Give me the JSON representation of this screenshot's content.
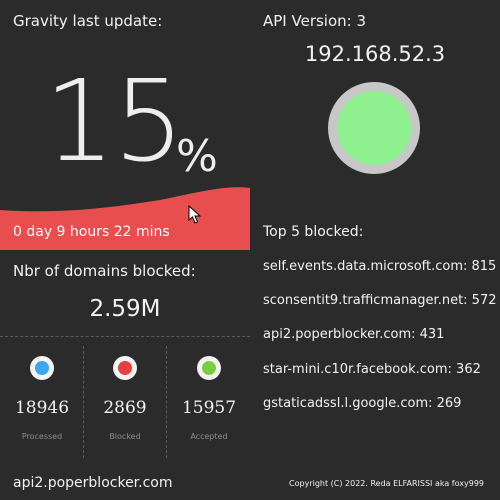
{
  "gravity": {
    "title": "Gravity last update:",
    "percent": "15",
    "percent_sign": "%",
    "duration": "0 day 9 hours 22 mins",
    "accent": "#e84e4e"
  },
  "domains": {
    "title": "Nbr of domains blocked:",
    "count": "2.59M"
  },
  "stats": [
    {
      "value": "18946",
      "label": "Processed",
      "color": "#3aa7f0"
    },
    {
      "value": "2869",
      "label": "Blocked",
      "color": "#e84040"
    },
    {
      "value": "15957",
      "label": "Accepted",
      "color": "#7ccc40"
    }
  ],
  "footer": {
    "domain": "api2.poperblocker.com",
    "copyright": "Copyright (C) 2022.  Reda ELFARISSI aka foxy999"
  },
  "api": {
    "version": "API Version: 3",
    "ip": "192.168.52.3",
    "status_color": "#8ff08f"
  },
  "top5": {
    "title": "Top 5 blocked:",
    "items": [
      "self.events.data.microsoft.com: 815",
      "sconsentit9.trafficmanager.net: 572",
      "api2.poperblocker.com: 431",
      "star-mini.c10r.facebook.com: 362",
      "gstaticadssl.l.google.com: 269"
    ]
  }
}
